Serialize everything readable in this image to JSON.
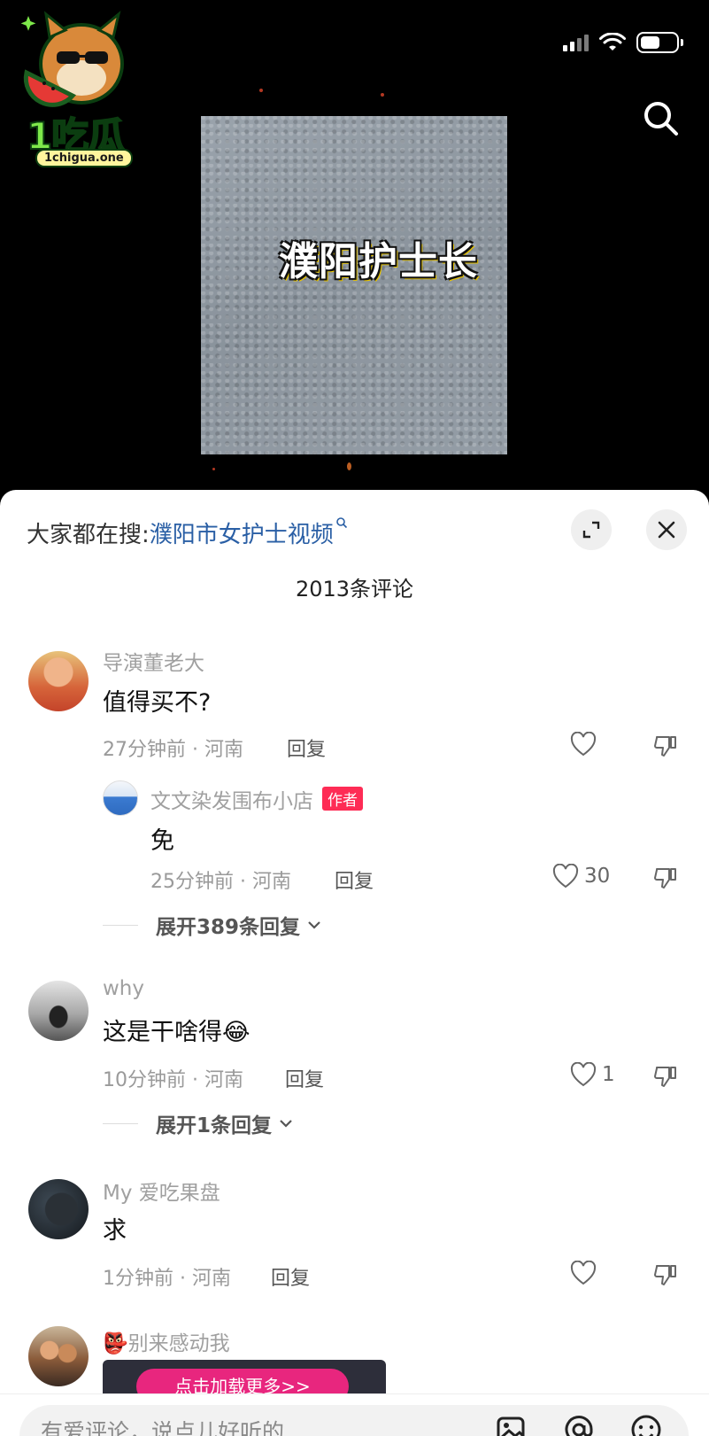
{
  "video": {
    "caption": "濮阳护士长",
    "logo_brand": "1吃瓜",
    "logo_url": "1chigua.one"
  },
  "sheet": {
    "trending_prefix": "大家都在搜:",
    "trending_keyword": "濮阳市女护士视频",
    "comment_count": "2013条评论",
    "reply_label": "回复"
  },
  "comments": [
    {
      "user": "导演董老大",
      "text": "值得买不?",
      "time_location": "27分钟前 · 河南",
      "likes": "",
      "reply": {
        "user": "文文染发围布小店",
        "badge": "作者",
        "text": "免",
        "time_location": "25分钟前 · 河南",
        "likes": "30"
      },
      "expand": "展开389条回复"
    },
    {
      "user": "why",
      "text": "这是干啥得",
      "emoji": "😂",
      "time_location": "10分钟前 · 河南",
      "likes": "1",
      "expand": "展开1条回复"
    },
    {
      "user": "My 爱吃果盘",
      "text": "求",
      "time_location": "1分钟前 · 河南",
      "likes": ""
    },
    {
      "user": "别来感动我",
      "user_emoji": "👺",
      "banner_text": "点击加载更多>>"
    }
  ],
  "input": {
    "placeholder": "有爱评论，说点儿好听的"
  },
  "colors": {
    "link": "#2a5fa5",
    "author_badge": "#fe2c55",
    "banner_pill": "#e8267e"
  }
}
